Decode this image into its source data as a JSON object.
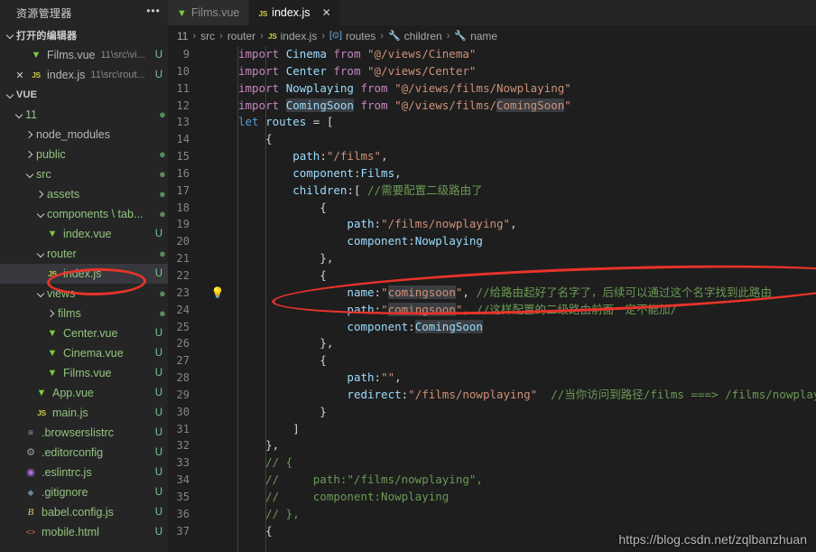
{
  "sidebar": {
    "header_title": "资源管理器",
    "more_icon": "ellipsis-icon",
    "open_editors": {
      "label": "打开的编辑器",
      "items": [
        {
          "icon": "vue-file-icon",
          "name": "Films.vue",
          "path": "11\\src\\vi...",
          "badge": "U",
          "close": ""
        },
        {
          "icon": "js-file-icon",
          "name": "index.js",
          "path": "11\\src\\rout...",
          "badge": "U",
          "close": "✕"
        }
      ]
    },
    "workspace": {
      "label": "VUE",
      "items": [
        {
          "icon": "chevron-down-icon",
          "name": "11",
          "badge": "●",
          "indent": 1,
          "kind": "folder"
        },
        {
          "icon": "chevron-right-icon",
          "name": "node_modules",
          "badge": "",
          "indent": 2,
          "kind": "folder"
        },
        {
          "icon": "chevron-right-icon",
          "name": "public",
          "badge": "●",
          "indent": 2,
          "kind": "folder"
        },
        {
          "icon": "chevron-down-icon",
          "name": "src",
          "badge": "●",
          "indent": 2,
          "kind": "folder"
        },
        {
          "icon": "chevron-right-icon",
          "name": "assets",
          "badge": "●",
          "indent": 3,
          "kind": "folder"
        },
        {
          "icon": "chevron-down-icon",
          "name": "components \\ tab...",
          "badge": "●",
          "indent": 3,
          "kind": "folder"
        },
        {
          "icon": "vue-file-icon",
          "name": "index.vue",
          "badge": "U",
          "indent": 4,
          "kind": "file"
        },
        {
          "icon": "chevron-down-icon",
          "name": "router",
          "badge": "●",
          "indent": 3,
          "kind": "folder"
        },
        {
          "icon": "js-file-icon",
          "name": "index.js",
          "badge": "U",
          "indent": 4,
          "kind": "file",
          "selected": true
        },
        {
          "icon": "chevron-down-icon",
          "name": "views",
          "badge": "●",
          "indent": 3,
          "kind": "folder"
        },
        {
          "icon": "chevron-right-icon",
          "name": "films",
          "badge": "●",
          "indent": 4,
          "kind": "folder"
        },
        {
          "icon": "vue-file-icon",
          "name": "Center.vue",
          "badge": "U",
          "indent": 4,
          "kind": "file"
        },
        {
          "icon": "vue-file-icon",
          "name": "Cinema.vue",
          "badge": "U",
          "indent": 4,
          "kind": "file"
        },
        {
          "icon": "vue-file-icon",
          "name": "Films.vue",
          "badge": "U",
          "indent": 4,
          "kind": "file"
        },
        {
          "icon": "vue-file-icon",
          "name": "App.vue",
          "badge": "U",
          "indent": 3,
          "kind": "file"
        },
        {
          "icon": "js-file-icon",
          "name": "main.js",
          "badge": "U",
          "indent": 3,
          "kind": "file"
        },
        {
          "icon": "list-icon",
          "name": ".browserslistrc",
          "badge": "U",
          "indent": 2,
          "kind": "file"
        },
        {
          "icon": "gear-icon",
          "name": ".editorconfig",
          "badge": "U",
          "indent": 2,
          "kind": "file"
        },
        {
          "icon": "eslint-icon",
          "name": ".eslintrc.js",
          "badge": "U",
          "indent": 2,
          "kind": "file"
        },
        {
          "icon": "git-icon",
          "name": ".gitignore",
          "badge": "U",
          "indent": 2,
          "kind": "file"
        },
        {
          "icon": "babel-icon",
          "name": "babel.config.js",
          "badge": "U",
          "indent": 2,
          "kind": "file"
        },
        {
          "icon": "html-icon",
          "name": "mobile.html",
          "badge": "U",
          "indent": 2,
          "kind": "file"
        }
      ]
    }
  },
  "tabs": [
    {
      "icon": "vue-file-icon",
      "label": "Films.vue",
      "active": false,
      "close": ""
    },
    {
      "icon": "js-file-icon",
      "label": "index.js",
      "active": true,
      "close": "✕"
    }
  ],
  "breadcrumb": [
    {
      "label": "11",
      "icon": ""
    },
    {
      "label": "src",
      "icon": ""
    },
    {
      "label": "router",
      "icon": ""
    },
    {
      "label": "index.js",
      "icon": "js-file-icon"
    },
    {
      "label": "routes",
      "icon": "symbol-variable-icon"
    },
    {
      "label": "children",
      "icon": "symbol-property-icon"
    },
    {
      "label": "name",
      "icon": "symbol-property-icon"
    }
  ],
  "breadcrumb_separator": "›",
  "editor": {
    "first_line": 9,
    "quickfix_line": 23,
    "quickfix_icon": "lightbulb-icon",
    "lines": [
      {
        "n": 9,
        "tokens": [
          {
            "t": "import ",
            "c": "kp"
          },
          {
            "t": "Cinema",
            "c": "id"
          },
          {
            "t": " from ",
            "c": "kp"
          },
          {
            "t": "\"@/views/Cinema\"",
            "c": "str"
          }
        ]
      },
      {
        "n": 10,
        "tokens": [
          {
            "t": "import ",
            "c": "kp"
          },
          {
            "t": "Center",
            "c": "id"
          },
          {
            "t": " from ",
            "c": "kp"
          },
          {
            "t": "\"@/views/Center\"",
            "c": "str"
          }
        ]
      },
      {
        "n": 11,
        "tokens": [
          {
            "t": "import ",
            "c": "kp"
          },
          {
            "t": "Nowplaying",
            "c": "id"
          },
          {
            "t": " from ",
            "c": "kp"
          },
          {
            "t": "\"@/views/films/Nowplaying\"",
            "c": "str"
          }
        ]
      },
      {
        "n": 12,
        "tokens": [
          {
            "t": "import ",
            "c": "kp"
          },
          {
            "t": "ComingSoon",
            "c": "id hl"
          },
          {
            "t": " from ",
            "c": "kp"
          },
          {
            "t": "\"@/views/films/",
            "c": "str"
          },
          {
            "t": "ComingSoon",
            "c": "str hl"
          },
          {
            "t": "\"",
            "c": "str"
          }
        ]
      },
      {
        "n": 13,
        "tokens": [
          {
            "t": "let ",
            "c": "k"
          },
          {
            "t": "routes",
            "c": "id"
          },
          {
            "t": " = ",
            "c": "pun"
          },
          {
            "t": "[",
            "c": "pun"
          }
        ]
      },
      {
        "n": 14,
        "tokens": [
          {
            "t": "    {",
            "c": "pun"
          }
        ]
      },
      {
        "n": 15,
        "tokens": [
          {
            "t": "        ",
            "c": "pun"
          },
          {
            "t": "path",
            "c": "id"
          },
          {
            "t": ":",
            "c": "pun"
          },
          {
            "t": "\"/films\"",
            "c": "str"
          },
          {
            "t": ",",
            "c": "pun"
          }
        ]
      },
      {
        "n": 16,
        "tokens": [
          {
            "t": "        ",
            "c": "pun"
          },
          {
            "t": "component",
            "c": "id"
          },
          {
            "t": ":",
            "c": "pun"
          },
          {
            "t": "Films",
            "c": "id"
          },
          {
            "t": ",",
            "c": "pun"
          }
        ]
      },
      {
        "n": 17,
        "tokens": [
          {
            "t": "        ",
            "c": "pun"
          },
          {
            "t": "children",
            "c": "id"
          },
          {
            "t": ":[ ",
            "c": "pun"
          },
          {
            "t": "//需要配置二级路由了",
            "c": "cmt"
          }
        ]
      },
      {
        "n": 18,
        "tokens": [
          {
            "t": "            {",
            "c": "pun"
          }
        ]
      },
      {
        "n": 19,
        "tokens": [
          {
            "t": "                ",
            "c": "pun"
          },
          {
            "t": "path",
            "c": "id"
          },
          {
            "t": ":",
            "c": "pun"
          },
          {
            "t": "\"/films/nowplaying\"",
            "c": "str"
          },
          {
            "t": ",",
            "c": "pun"
          }
        ]
      },
      {
        "n": 20,
        "tokens": [
          {
            "t": "                ",
            "c": "pun"
          },
          {
            "t": "component",
            "c": "id"
          },
          {
            "t": ":",
            "c": "pun"
          },
          {
            "t": "Nowplaying",
            "c": "id"
          }
        ]
      },
      {
        "n": 21,
        "tokens": [
          {
            "t": "            },",
            "c": "pun"
          }
        ]
      },
      {
        "n": 22,
        "tokens": [
          {
            "t": "            {",
            "c": "pun"
          }
        ]
      },
      {
        "n": 23,
        "tokens": [
          {
            "t": "                ",
            "c": "pun"
          },
          {
            "t": "name",
            "c": "id"
          },
          {
            "t": ":",
            "c": "pun"
          },
          {
            "t": "\"",
            "c": "str"
          },
          {
            "t": "comingsoon",
            "c": "str hl"
          },
          {
            "t": "\"",
            "c": "str"
          },
          {
            "t": ", ",
            "c": "pun"
          },
          {
            "t": "//给路由起好了名字了，后续可以通过这个名字找到此路由",
            "c": "cmt"
          }
        ]
      },
      {
        "n": 24,
        "tokens": [
          {
            "t": "                ",
            "c": "pun"
          },
          {
            "t": "path",
            "c": "id"
          },
          {
            "t": ":",
            "c": "pun"
          },
          {
            "t": "\"",
            "c": "str"
          },
          {
            "t": "comingsoon",
            "c": "str hl"
          },
          {
            "t": "\"",
            "c": "str"
          },
          {
            "t": ", ",
            "c": "pun"
          },
          {
            "t": "//这样配置的二级路由前面一定不能加/",
            "c": "cmt"
          }
        ]
      },
      {
        "n": 25,
        "tokens": [
          {
            "t": "                ",
            "c": "pun"
          },
          {
            "t": "component",
            "c": "id"
          },
          {
            "t": ":",
            "c": "pun"
          },
          {
            "t": "ComingSoon",
            "c": "id hl"
          }
        ]
      },
      {
        "n": 26,
        "tokens": [
          {
            "t": "            },",
            "c": "pun"
          }
        ]
      },
      {
        "n": 27,
        "tokens": [
          {
            "t": "            {",
            "c": "pun"
          }
        ]
      },
      {
        "n": 28,
        "tokens": [
          {
            "t": "                ",
            "c": "pun"
          },
          {
            "t": "path",
            "c": "id"
          },
          {
            "t": ":",
            "c": "pun"
          },
          {
            "t": "\"\"",
            "c": "str"
          },
          {
            "t": ",",
            "c": "pun"
          }
        ]
      },
      {
        "n": 29,
        "tokens": [
          {
            "t": "                ",
            "c": "pun"
          },
          {
            "t": "redirect",
            "c": "id"
          },
          {
            "t": ":",
            "c": "pun"
          },
          {
            "t": "\"/films/nowplaying\"",
            "c": "str"
          },
          {
            "t": "  ",
            "c": "pun"
          },
          {
            "t": "//当你访问到路径/films ===> /films/nowplaying",
            "c": "cmt"
          }
        ]
      },
      {
        "n": 30,
        "tokens": [
          {
            "t": "            }",
            "c": "pun"
          }
        ]
      },
      {
        "n": 31,
        "tokens": [
          {
            "t": "        ]",
            "c": "pun"
          }
        ]
      },
      {
        "n": 32,
        "tokens": [
          {
            "t": "    },",
            "c": "pun"
          }
        ]
      },
      {
        "n": 33,
        "tokens": [
          {
            "t": "    // {",
            "c": "cmt"
          }
        ]
      },
      {
        "n": 34,
        "tokens": [
          {
            "t": "    //     path:\"/films/nowplaying\",",
            "c": "cmt"
          }
        ]
      },
      {
        "n": 35,
        "tokens": [
          {
            "t": "    //     component:Nowplaying",
            "c": "cmt"
          }
        ]
      },
      {
        "n": 36,
        "tokens": [
          {
            "t": "    // },",
            "c": "cmt"
          }
        ]
      },
      {
        "n": 37,
        "tokens": [
          {
            "t": "    {",
            "c": "pun"
          }
        ]
      }
    ]
  },
  "annotations": {
    "ellipse_code": "red-ellipse-highlight",
    "ellipse_sidebar": "red-ellipse-highlight"
  },
  "watermark": "https://blog.csdn.net/zqlbanzhuan",
  "colors": {
    "editor_bg": "#1e1e1e",
    "sidebar_bg": "#252526",
    "accent_red": "#e8332a",
    "badge_green": "#73c991",
    "vue_green": "#7ecb3e",
    "js_yellow": "#cbcb41"
  }
}
